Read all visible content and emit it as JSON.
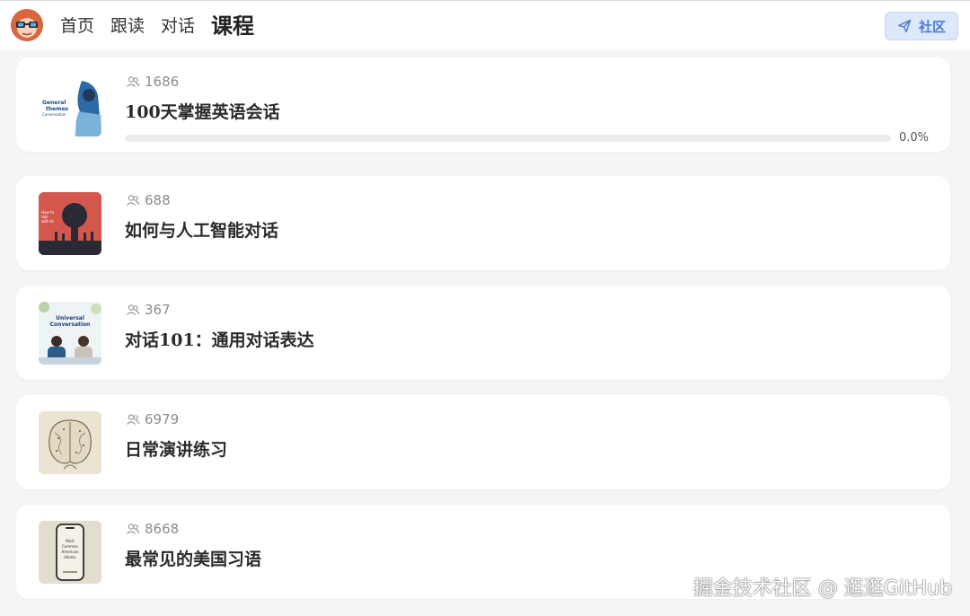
{
  "header": {
    "nav": [
      {
        "label": "首页"
      },
      {
        "label": "跟读"
      },
      {
        "label": "对话"
      },
      {
        "label": "课程"
      }
    ],
    "active_nav": "课程",
    "community_button": {
      "label": "社区",
      "icon": "paper-plane-icon"
    }
  },
  "courses": [
    {
      "learners": "1686",
      "title": "100天掌握英语会话",
      "progress": "0.0%",
      "progress_value": 0.0,
      "thumb_text": [
        "General",
        "themes",
        "Conversation"
      ]
    },
    {
      "learners": "688",
      "title": "如何与人工智能对话",
      "thumb_text": [
        "How to",
        "talk",
        "with AI"
      ]
    },
    {
      "learners": "367",
      "title": "对话101：通用对话表达",
      "thumb_text": [
        "Universal",
        "Conversation"
      ]
    },
    {
      "learners": "6979",
      "title": "日常演讲练习"
    },
    {
      "learners": "8668",
      "title": "最常见的美国习语",
      "thumb_text": [
        "Most",
        "Common",
        "American",
        "Idioms"
      ]
    }
  ],
  "watermark": "掘金技术社区 @ 逛逛GitHub",
  "colors": {
    "accent": "#4a7ad0",
    "community_bg": "#dde8fb",
    "background": "#f5f5f6"
  }
}
